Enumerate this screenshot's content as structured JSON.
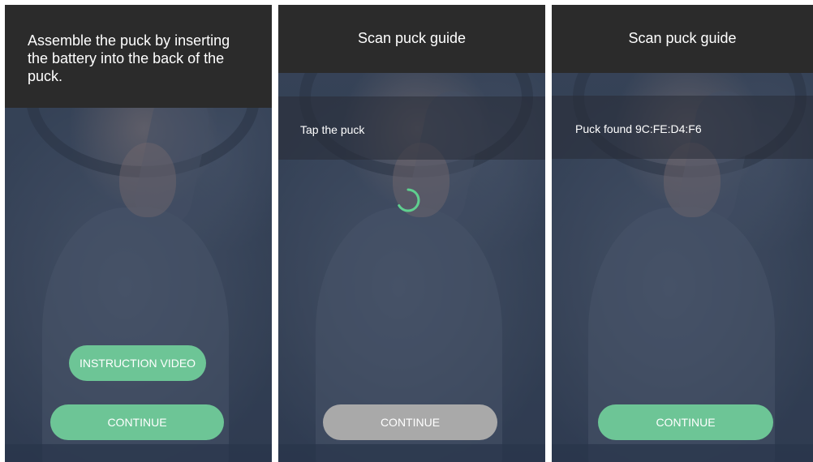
{
  "screens": [
    {
      "header": "Assemble the puck by inserting the battery into the back of the puck.",
      "instruction_video_label": "INSTRUCTION VIDEO",
      "continue_label": "CONTINUE",
      "continue_state": "enabled"
    },
    {
      "header": "Scan puck guide",
      "status": "Tap the puck",
      "loading": true,
      "continue_label": "CONTINUE",
      "continue_state": "disabled"
    },
    {
      "header": "Scan puck guide",
      "status": "Puck found 9C:FE:D4:F6",
      "continue_label": "CONTINUE",
      "continue_state": "enabled"
    }
  ],
  "colors": {
    "header_bg": "#2b2b2b",
    "accent_green": "#6dc596",
    "disabled_grey": "#a9a9a9",
    "spinner": "#5fd08f"
  },
  "icons": {
    "loading": "loading-spinner-icon"
  }
}
